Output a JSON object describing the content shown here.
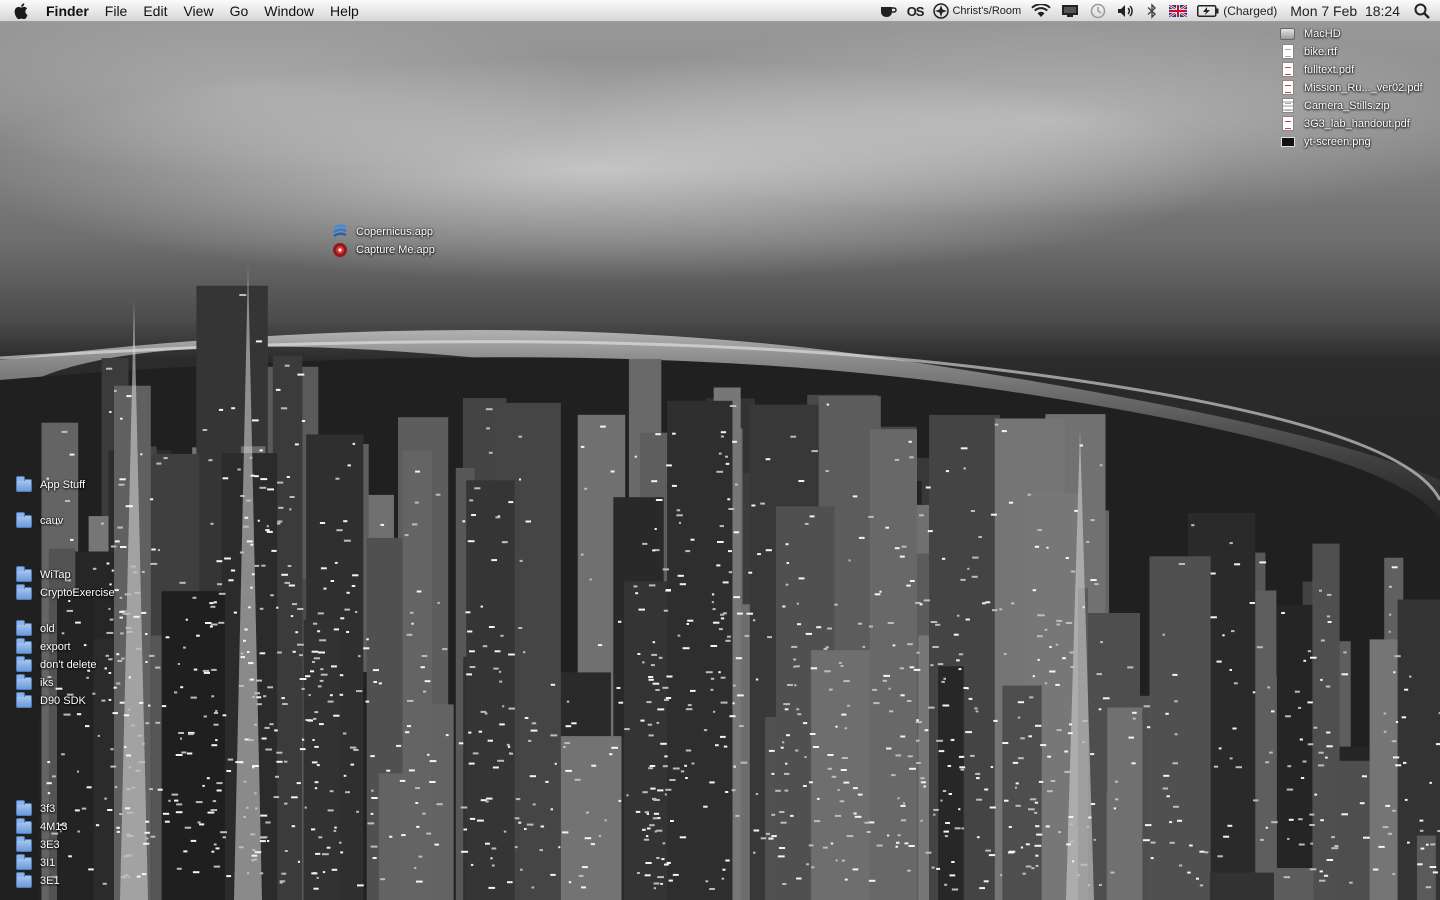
{
  "menubar": {
    "apple_icon": "apple-logo-icon",
    "app_name": "Finder",
    "menus": [
      "File",
      "Edit",
      "View",
      "Go",
      "Window",
      "Help"
    ],
    "status": {
      "caffeine_icon": "coffee-cup-icon",
      "os_label": "OS",
      "location": "Christ's/Room",
      "wifi_icon": "wifi-icon",
      "display_icon": "display-mirroring-icon",
      "timemachine_icon": "time-machine-icon",
      "volume_icon": "volume-icon",
      "bluetooth_icon": "bluetooth-icon",
      "input_source_icon": "uk-flag-icon",
      "battery_status": "(Charged)",
      "clock": "Mon 7 Feb  18:24",
      "spotlight_icon": "spotlight-search-icon"
    }
  },
  "desktop": {
    "right_column": [
      {
        "name": "MacHD",
        "kind": "drive"
      },
      {
        "name": "bike.rtf",
        "kind": "doc"
      },
      {
        "name": "fulltext.pdf",
        "kind": "pdf"
      },
      {
        "name": "Mission_Ru..._ver02.pdf",
        "kind": "pdf"
      },
      {
        "name": "Camera_Stills.zip",
        "kind": "zip"
      },
      {
        "name": "3G3_lab_handout.pdf",
        "kind": "pdf"
      },
      {
        "name": "yt-screen.png",
        "kind": "png"
      }
    ],
    "apps": [
      {
        "name": "Copernicus.app",
        "icon": "copernicus-app-icon"
      },
      {
        "name": "Capture Me.app",
        "icon": "capture-me-app-icon"
      }
    ],
    "left_folders": [
      {
        "name": "App Stuff"
      },
      {
        "name": "cauv"
      },
      {
        "name": "WiTap"
      },
      {
        "name": "CryptoExercise"
      },
      {
        "name": "old"
      },
      {
        "name": "export"
      },
      {
        "name": "don't delete"
      },
      {
        "name": "iks"
      },
      {
        "name": "D90 SDK"
      },
      {
        "name": "3f3"
      },
      {
        "name": "4M13"
      },
      {
        "name": "3E3"
      },
      {
        "name": "3I1"
      },
      {
        "name": "3E1"
      }
    ]
  },
  "colors": {
    "menubar_top": "#fbfbfb",
    "menubar_bottom": "#d6d6d6",
    "folder_blue": "#6e9ad8",
    "label_text": "#ffffff"
  }
}
